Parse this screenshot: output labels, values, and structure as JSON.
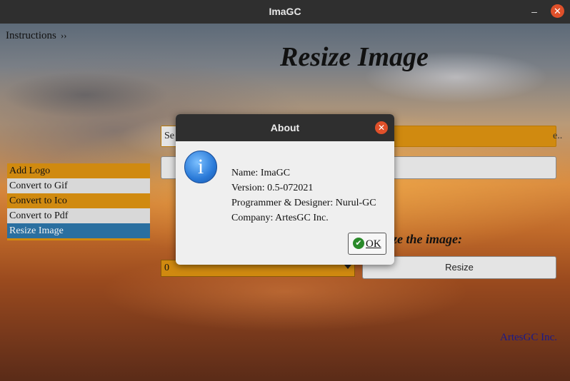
{
  "window": {
    "title": "ImaGC",
    "minimize_glyph": "–",
    "close_glyph": "✕"
  },
  "instructions": {
    "label": "Instructions",
    "arrow": "››"
  },
  "page_title": "Resize Image",
  "menu": {
    "items": [
      {
        "label": "Add Logo"
      },
      {
        "label": "Convert to Gif"
      },
      {
        "label": "Convert to Ico"
      },
      {
        "label": "Convert to Pdf"
      },
      {
        "label": "Resize Image"
      }
    ]
  },
  "main": {
    "select_button_partial": "Se",
    "field_hint_partial": "e..",
    "resize_label_partial": "ze the image:",
    "combo_value": "0",
    "resize_button": "Resize",
    "company_link": "ArtesGC Inc."
  },
  "dialog": {
    "title": "About",
    "close_glyph": "✕",
    "icon_glyph": "i",
    "lines": [
      "Name: ImaGC",
      "Version: 0.5-072021",
      "Programmer & Designer: Nurul-GC",
      "Company: ArtesGC Inc."
    ],
    "ok_label": "OK",
    "ok_icon": "✔"
  },
  "colors": {
    "accent": "#d08a10",
    "selected": "#2a6fa0",
    "close": "#e0502a"
  }
}
